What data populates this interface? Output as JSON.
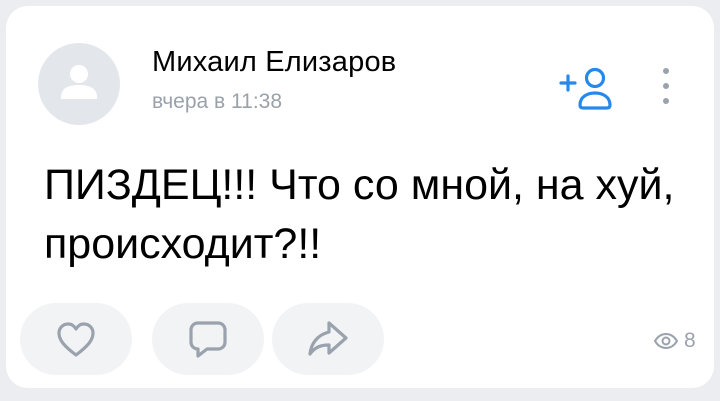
{
  "post": {
    "author": "Михаил Елизаров",
    "timestamp": "вчера в 11:38",
    "text": "ПИЗДЕЦ!!! Что со мной, на хуй, происходит?!!",
    "views": "8"
  },
  "icons": {
    "avatar": "user-placeholder-icon",
    "add_friend": "add-friend-icon",
    "more": "more-vertical-icon",
    "like": "heart-icon",
    "comment": "comment-icon",
    "share": "share-icon",
    "views": "eye-icon"
  },
  "colors": {
    "accent": "#2688eb",
    "action_icon": "#99a2ad",
    "secondary_text": "#9aa1a9",
    "button_bg": "#f2f3f5",
    "page_bg": "#ebedf0"
  }
}
